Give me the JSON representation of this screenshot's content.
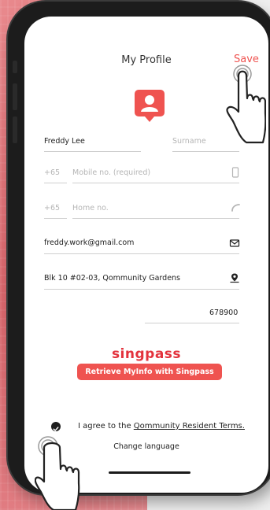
{
  "header": {
    "title": "My Profile",
    "save_label": "Save"
  },
  "form": {
    "first_name": {
      "value": "Freddy Lee"
    },
    "surname": {
      "placeholder": "Surname"
    },
    "mobile": {
      "prefix": "+65",
      "placeholder": "Mobile no. (required)"
    },
    "home": {
      "prefix": "+65",
      "placeholder": "Home no."
    },
    "email": {
      "value": "freddy.work@gmail.com"
    },
    "address": {
      "value": "Blk 10 #02-03, Qommunity Gardens"
    },
    "postal": {
      "value": "678900"
    }
  },
  "singpass": {
    "logo_text": "singpass",
    "button_label": "Retrieve MyInfo with Singpass"
  },
  "terms": {
    "prefix": "I agree to the ",
    "link": "Qommunity Resident Terms."
  },
  "language": {
    "label": "Change language"
  },
  "colors": {
    "accent": "#ef5350",
    "singpass_red": "#e3323c"
  },
  "icons": [
    "profile-icon",
    "phone-icon",
    "telephone-icon",
    "mail-icon",
    "location-icon",
    "check-icon",
    "tap-hand-icon"
  ]
}
